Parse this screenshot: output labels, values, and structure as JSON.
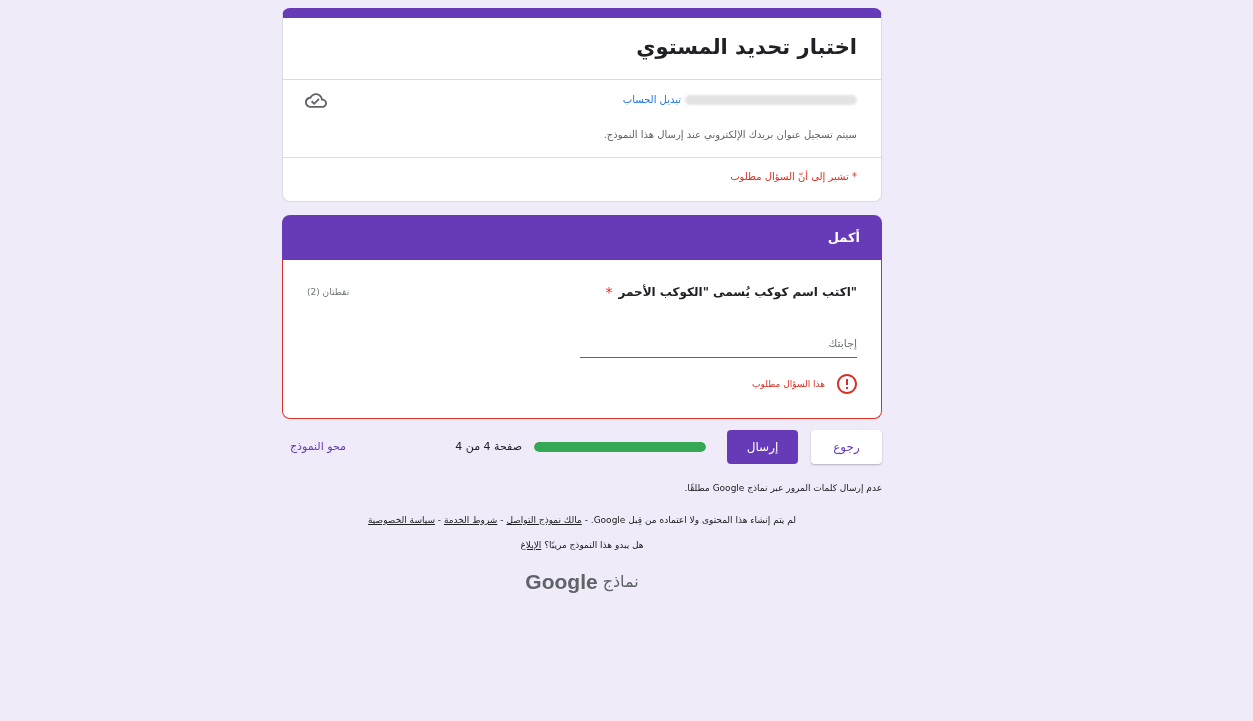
{
  "header_card": {
    "title": "اختبار تحديد المستوي",
    "account": {
      "switch_account": "تبديل الحساب",
      "notice": "سيتم تسجيل عنوان بريدك الإلكتروني عند إرسال هذا النموذج."
    },
    "required_note": "* تشير إلى أنّ السؤال مطلوب"
  },
  "section": {
    "title": "أكمل",
    "questions": [
      {
        "text": "\"اكتب اسم كوكب يُسمى \"الكوكب الأحمر",
        "required": true,
        "required_mark": "*",
        "points": "نقطتان (2)",
        "answer": {
          "placeholder": "إجابتك"
        },
        "invalid": true,
        "error": "هذا السؤال مطلوب"
      }
    ]
  },
  "navigation": {
    "buttons": [
      {
        "label": "رجوع",
        "kind": "secondary"
      },
      {
        "label": "إرسال",
        "kind": "primary"
      }
    ],
    "progress": {
      "level": 1,
      "label": "صفحة 4 من 4"
    },
    "clear_form": "محو النموذج"
  },
  "footer": {
    "password_warning": "عدم إرسال كلمات المرور عبر نماذج Google مطلقًا.",
    "disclaimer": [
      {
        "kind": "text",
        "text": "لم يتم إنشاء هذا المحتوى ولا اعتماده من قِبل Google."
      },
      {
        "kind": "text",
        "text": "-"
      },
      {
        "kind": "link",
        "text": "مالك نموذج التواصل"
      },
      {
        "kind": "text",
        "text": "-"
      },
      {
        "kind": "link",
        "text": "شروط الخدمة"
      },
      {
        "kind": "text",
        "text": "-"
      },
      {
        "kind": "link",
        "text": "سياسة الخصوصية"
      }
    ],
    "report": [
      {
        "kind": "text",
        "text": "هل يبدو هذا النموذج مريبًا؟"
      },
      {
        "kind": "link",
        "text": "الإبلاغ"
      }
    ],
    "logo": {
      "brand": "Google",
      "product": "نماذج"
    }
  }
}
